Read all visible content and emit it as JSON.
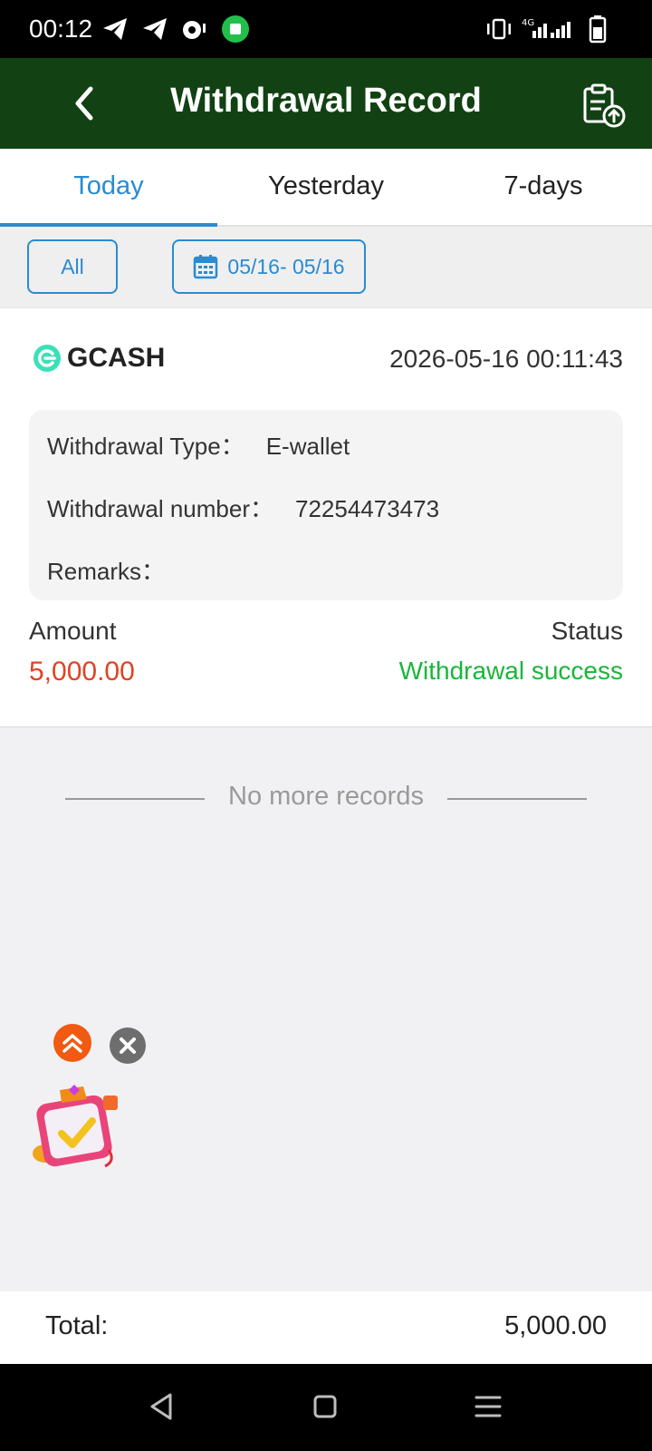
{
  "status_bar": {
    "time": "00:12",
    "network": "4G"
  },
  "header": {
    "title": "Withdrawal Record"
  },
  "tabs": [
    {
      "label": "Today",
      "active": true
    },
    {
      "label": "Yesterday",
      "active": false
    },
    {
      "label": "7-days",
      "active": false
    }
  ],
  "filters": {
    "all_label": "All",
    "date_range": "05/16- 05/16"
  },
  "record": {
    "method": "GCASH",
    "datetime": "2026-05-16 00:11:43",
    "type_label": "Withdrawal Type：",
    "type_value": "E-wallet",
    "number_label": "Withdrawal number：",
    "number_value": "72254473473",
    "remarks_label": "Remarks：",
    "remarks_value": "",
    "amount_label": "Amount",
    "amount_value": "5,000.00",
    "status_label": "Status",
    "status_value": "Withdrawal success"
  },
  "list_end_text": "No more records",
  "footer": {
    "total_label": "Total:",
    "total_value": "5,000.00"
  },
  "colors": {
    "header_bg": "#124213",
    "accent": "#2a8bd0",
    "amount": "#e04224",
    "success": "#1ab63a"
  }
}
